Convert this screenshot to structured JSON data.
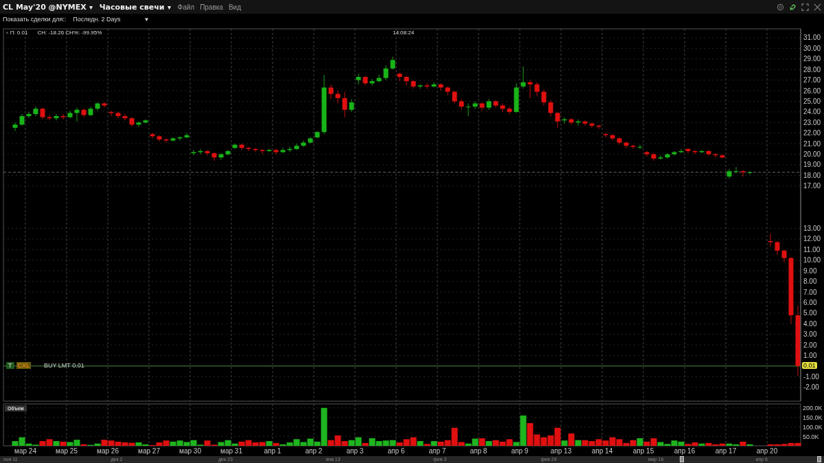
{
  "header": {
    "symbol": "CL May'20 @NYMEX",
    "symbol_caret": "▾",
    "bar_type": "Часовые свечи",
    "bar_type_caret": "▾",
    "menu": [
      "Файл",
      "Правка",
      "Вид"
    ]
  },
  "filter": {
    "label": "Показать сделки для::",
    "value": "Последн. 2 Days",
    "caret": "▼"
  },
  "legend": {
    "close_icon": "×",
    "close": "П: 0.01",
    "change": "CH: -18.26 CH%: -99.95%",
    "time": "14:08:24"
  },
  "order": {
    "transmit": "T",
    "cancel": "CXL",
    "label": "BUY LMT 0.01",
    "price_tag": "0.01"
  },
  "price_chart": {
    "chart_data": {
      "type": "candlestick",
      "grid": true,
      "ylim": [
        -3.31,
        31.84
      ],
      "yticks": [
        {
          "value": 31,
          "label": "31.00"
        },
        {
          "value": 30,
          "label": "30.00"
        },
        {
          "value": 29,
          "label": "29.00"
        },
        {
          "value": 28,
          "label": "28.00"
        },
        {
          "value": 27,
          "label": "27.00"
        },
        {
          "value": 26,
          "label": "26.00"
        },
        {
          "value": 25,
          "label": "25.00"
        },
        {
          "value": 24,
          "label": "24.00"
        },
        {
          "value": 23,
          "label": "23.00"
        },
        {
          "value": 22,
          "label": "22.00"
        },
        {
          "value": 21,
          "label": "21.00"
        },
        {
          "value": 20,
          "label": "20.00"
        },
        {
          "value": 19,
          "label": "19.00"
        },
        {
          "value": 18,
          "label": "18.00"
        },
        {
          "value": 17,
          "label": "17.00"
        },
        {
          "value": 13,
          "label": "13.00"
        },
        {
          "value": 12,
          "label": "12.00"
        },
        {
          "value": 11,
          "label": "11.00"
        },
        {
          "value": 10,
          "label": "10.00"
        },
        {
          "value": 9,
          "label": "9.00"
        },
        {
          "value": 8,
          "label": "8.00"
        },
        {
          "value": 7,
          "label": "7.00"
        },
        {
          "value": 6,
          "label": "6.00"
        },
        {
          "value": 5,
          "label": "5.00"
        },
        {
          "value": 4,
          "label": "4.00"
        },
        {
          "value": 3,
          "label": "3.00"
        },
        {
          "value": 2,
          "label": "2.00"
        },
        {
          "value": 1,
          "label": "1.00"
        },
        {
          "value": -1,
          "label": "-1.00"
        },
        {
          "value": -2,
          "label": "-2.00"
        }
      ],
      "ref_lines": [
        {
          "axis": "y",
          "value": 18.3
        }
      ],
      "ohlc": [
        [
          22.5,
          23.0,
          22.2,
          22.8
        ],
        [
          22.8,
          23.8,
          22.7,
          23.6
        ],
        [
          23.6,
          24.0,
          23.4,
          23.8
        ],
        [
          23.8,
          24.5,
          23.6,
          24.3
        ],
        [
          24.3,
          24.4,
          23.3,
          23.5
        ],
        [
          23.5,
          23.7,
          23.2,
          23.4
        ],
        [
          23.4,
          23.8,
          23.2,
          23.6
        ],
        [
          23.6,
          23.8,
          23.3,
          23.5
        ],
        [
          23.5,
          24.1,
          23.4,
          23.9
        ],
        [
          23.9,
          24.4,
          23.1,
          24.2
        ],
        [
          24.2,
          24.3,
          23.5,
          23.7
        ],
        [
          23.7,
          24.5,
          23.6,
          24.3
        ],
        [
          24.3,
          24.9,
          24.1,
          24.8
        ],
        [
          24.8,
          24.9,
          24.4,
          24.6
        ],
        [
          24.0,
          24.1,
          23.6,
          23.9
        ],
        [
          23.9,
          24.0,
          23.4,
          23.6
        ],
        [
          23.6,
          23.8,
          23.2,
          23.4
        ],
        [
          23.4,
          23.5,
          22.6,
          22.8
        ],
        [
          22.8,
          23.1,
          22.6,
          23.0
        ],
        [
          23.0,
          23.3,
          22.9,
          23.2
        ],
        [
          21.9,
          22.0,
          21.5,
          21.7
        ],
        [
          21.7,
          21.8,
          21.2,
          21.4
        ],
        [
          21.4,
          21.5,
          21.1,
          21.3
        ],
        [
          21.3,
          21.6,
          21.2,
          21.5
        ],
        [
          21.5,
          21.7,
          21.3,
          21.6
        ],
        [
          21.6,
          22.0,
          21.5,
          21.8
        ],
        [
          20.1,
          20.4,
          19.9,
          20.2
        ],
        [
          20.2,
          20.5,
          20.0,
          20.3
        ],
        [
          20.3,
          20.4,
          19.9,
          20.1
        ],
        [
          20.1,
          20.2,
          19.4,
          19.7
        ],
        [
          19.7,
          20.1,
          19.5,
          20.0
        ],
        [
          20.0,
          20.4,
          19.9,
          20.3
        ],
        [
          20.6,
          21.0,
          20.5,
          20.9
        ],
        [
          20.9,
          21.0,
          20.4,
          20.6
        ],
        [
          20.6,
          20.7,
          20.3,
          20.5
        ],
        [
          20.5,
          20.6,
          20.2,
          20.4
        ],
        [
          20.4,
          20.5,
          20.0,
          20.3
        ],
        [
          20.3,
          20.5,
          20.2,
          20.4
        ],
        [
          20.4,
          20.5,
          20.0,
          20.2
        ],
        [
          20.2,
          20.6,
          20.1,
          20.4
        ],
        [
          20.4,
          20.7,
          20.2,
          20.5
        ],
        [
          20.5,
          21.0,
          20.4,
          20.8
        ],
        [
          20.8,
          21.3,
          20.7,
          21.1
        ],
        [
          21.1,
          21.6,
          21.0,
          21.5
        ],
        [
          21.6,
          22.2,
          21.5,
          22.1
        ],
        [
          22.1,
          27.5,
          21.9,
          26.3
        ],
        [
          26.3,
          26.6,
          25.2,
          25.7
        ],
        [
          25.7,
          26.0,
          24.8,
          25.3
        ],
        [
          25.3,
          25.9,
          23.5,
          24.2
        ],
        [
          24.2,
          25.2,
          24.0,
          24.9
        ],
        [
          27.0,
          27.6,
          26.6,
          27.3
        ],
        [
          27.3,
          27.4,
          26.5,
          26.7
        ],
        [
          26.7,
          27.1,
          26.5,
          26.9
        ],
        [
          26.9,
          27.5,
          26.8,
          27.2
        ],
        [
          27.2,
          28.4,
          27.0,
          28.1
        ],
        [
          28.1,
          29.2,
          28.0,
          28.9
        ],
        [
          27.6,
          27.7,
          26.9,
          27.3
        ],
        [
          27.3,
          27.4,
          26.5,
          26.9
        ],
        [
          26.9,
          27.0,
          26.2,
          26.4
        ],
        [
          26.4,
          26.6,
          26.2,
          26.5
        ],
        [
          26.5,
          26.7,
          26.2,
          26.4
        ],
        [
          26.4,
          26.8,
          26.3,
          26.6
        ],
        [
          26.6,
          26.7,
          26.0,
          26.3
        ],
        [
          26.3,
          26.4,
          25.6,
          25.9
        ],
        [
          25.9,
          26.0,
          24.8,
          25.0
        ],
        [
          25.0,
          25.2,
          24.2,
          24.5
        ],
        [
          24.5,
          24.8,
          23.6,
          24.5
        ],
        [
          24.5,
          25.0,
          24.3,
          24.8
        ],
        [
          24.8,
          24.9,
          24.1,
          24.4
        ],
        [
          24.4,
          25.2,
          24.2,
          25.0
        ],
        [
          25.0,
          25.1,
          24.4,
          24.6
        ],
        [
          24.6,
          24.8,
          24.0,
          24.3
        ],
        [
          24.3,
          24.5,
          23.8,
          24.0
        ],
        [
          24.0,
          26.7,
          23.9,
          26.3
        ],
        [
          26.4,
          28.3,
          26.2,
          26.8
        ],
        [
          26.8,
          27.0,
          25.3,
          26.6
        ],
        [
          26.6,
          26.8,
          25.5,
          25.9
        ],
        [
          25.9,
          26.1,
          24.6,
          24.9
        ],
        [
          24.9,
          25.1,
          23.6,
          23.9
        ],
        [
          23.9,
          24.0,
          22.5,
          23.1
        ],
        [
          23.2,
          23.5,
          22.9,
          23.3
        ],
        [
          23.3,
          23.4,
          22.8,
          23.0
        ],
        [
          23.0,
          23.3,
          22.7,
          23.1
        ],
        [
          23.1,
          23.2,
          22.7,
          22.9
        ],
        [
          22.9,
          23.0,
          22.5,
          22.7
        ],
        [
          22.7,
          22.8,
          22.4,
          22.6
        ],
        [
          21.9,
          22.0,
          21.6,
          21.8
        ],
        [
          21.8,
          21.9,
          21.3,
          21.5
        ],
        [
          21.5,
          21.6,
          20.9,
          21.1
        ],
        [
          21.1,
          21.2,
          20.6,
          20.8
        ],
        [
          20.8,
          20.9,
          20.5,
          20.7
        ],
        [
          20.7,
          20.9,
          20.5,
          20.7
        ],
        [
          20.2,
          20.3,
          19.8,
          20.0
        ],
        [
          20.0,
          20.1,
          19.4,
          19.6
        ],
        [
          19.6,
          19.9,
          19.5,
          19.7
        ],
        [
          19.7,
          20.1,
          19.6,
          20.0
        ],
        [
          20.0,
          20.3,
          19.9,
          20.2
        ],
        [
          20.2,
          20.5,
          20.1,
          20.3
        ],
        [
          20.5,
          20.6,
          20.1,
          20.3
        ],
        [
          20.3,
          20.4,
          20.0,
          20.2
        ],
        [
          20.2,
          20.4,
          20.1,
          20.3
        ],
        [
          20.3,
          20.4,
          19.9,
          20.0
        ],
        [
          20.0,
          20.1,
          19.7,
          19.9
        ],
        [
          19.9,
          20.0,
          19.6,
          19.7
        ],
        [
          17.9,
          18.6,
          17.7,
          18.4
        ],
        [
          18.4,
          18.8,
          18.2,
          18.4
        ],
        [
          18.4,
          18.5,
          17.9,
          18.3
        ],
        [
          18.3,
          18.4,
          18.1,
          18.3
        ],
        null,
        null,
        [
          11.8,
          12.5,
          11.3,
          11.7
        ],
        [
          11.7,
          11.8,
          10.5,
          10.9
        ],
        [
          10.9,
          11.0,
          9.8,
          10.2
        ],
        [
          10.2,
          10.3,
          4.0,
          4.8
        ],
        [
          4.8,
          5.7,
          -0.9,
          0.01
        ]
      ]
    }
  },
  "volume_panel": {
    "chart_data": {
      "type": "bar",
      "grid": true,
      "ylim": [
        0,
        221
      ],
      "yticks": [
        {
          "value": 200,
          "label": "200.0K"
        },
        {
          "value": 150,
          "label": "150.0K"
        },
        {
          "value": 100,
          "label": "100.0K"
        },
        {
          "value": 50,
          "label": "50.0K"
        }
      ],
      "categories": [
        null,
        null,
        "мар 24",
        null,
        null,
        null,
        null,
        null,
        "мар 25",
        null,
        null,
        null,
        null,
        null,
        "мар 26",
        null,
        null,
        null,
        null,
        null,
        "мар 27",
        null,
        null,
        null,
        null,
        null,
        "мар 30",
        null,
        null,
        null,
        null,
        null,
        "мар 31",
        null,
        null,
        null,
        null,
        null,
        "апр 1",
        null,
        null,
        null,
        null,
        null,
        "апр 2",
        null,
        null,
        null,
        null,
        null,
        "апр 3",
        null,
        null,
        null,
        null,
        null,
        "апр 6",
        null,
        null,
        null,
        null,
        null,
        "апр 7",
        null,
        null,
        null,
        null,
        null,
        "апр 8",
        null,
        null,
        null,
        null,
        null,
        "апр 9",
        null,
        null,
        null,
        null,
        null,
        "апр 13",
        null,
        null,
        null,
        null,
        null,
        "апр 14",
        null,
        null,
        null,
        null,
        null,
        "апр 15",
        null,
        null,
        null,
        null,
        null,
        "апр 16",
        null,
        null,
        null,
        null,
        null,
        "апр 17",
        null,
        null,
        null,
        null,
        null,
        "апр 20",
        null,
        null,
        null,
        null
      ],
      "series": [
        {
          "name": "Объем",
          "values": [
            25,
            45,
            12,
            6,
            25,
            35,
            25,
            22,
            20,
            32,
            8,
            5,
            12,
            32,
            28,
            22,
            18,
            16,
            18,
            8,
            4,
            18,
            28,
            22,
            28,
            20,
            30,
            6,
            28,
            6,
            20,
            30,
            12,
            22,
            30,
            18,
            20,
            25,
            15,
            8,
            18,
            35,
            20,
            38,
            22,
            200,
            30,
            55,
            25,
            30,
            45,
            15,
            40,
            25,
            28,
            30,
            18,
            35,
            45,
            25,
            10,
            25,
            22,
            30,
            95,
            20,
            12,
            38,
            40,
            25,
            30,
            22,
            35,
            20,
            160,
            120,
            60,
            45,
            55,
            95,
            28,
            65,
            30,
            30,
            25,
            35,
            28,
            45,
            35,
            15,
            30,
            40,
            22,
            40,
            20,
            10,
            28,
            22,
            10,
            18,
            12,
            15,
            8,
            12,
            12,
            8,
            22,
            8,
            null,
            null,
            8,
            8,
            10,
            15,
            15
          ]
        }
      ]
    }
  },
  "navigator": {
    "labels": [
      "ноя 11",
      "дек 2",
      "дек 23",
      "янв 13",
      "фев 3",
      "фев 24",
      "мар 16",
      "апр 6"
    ]
  }
}
